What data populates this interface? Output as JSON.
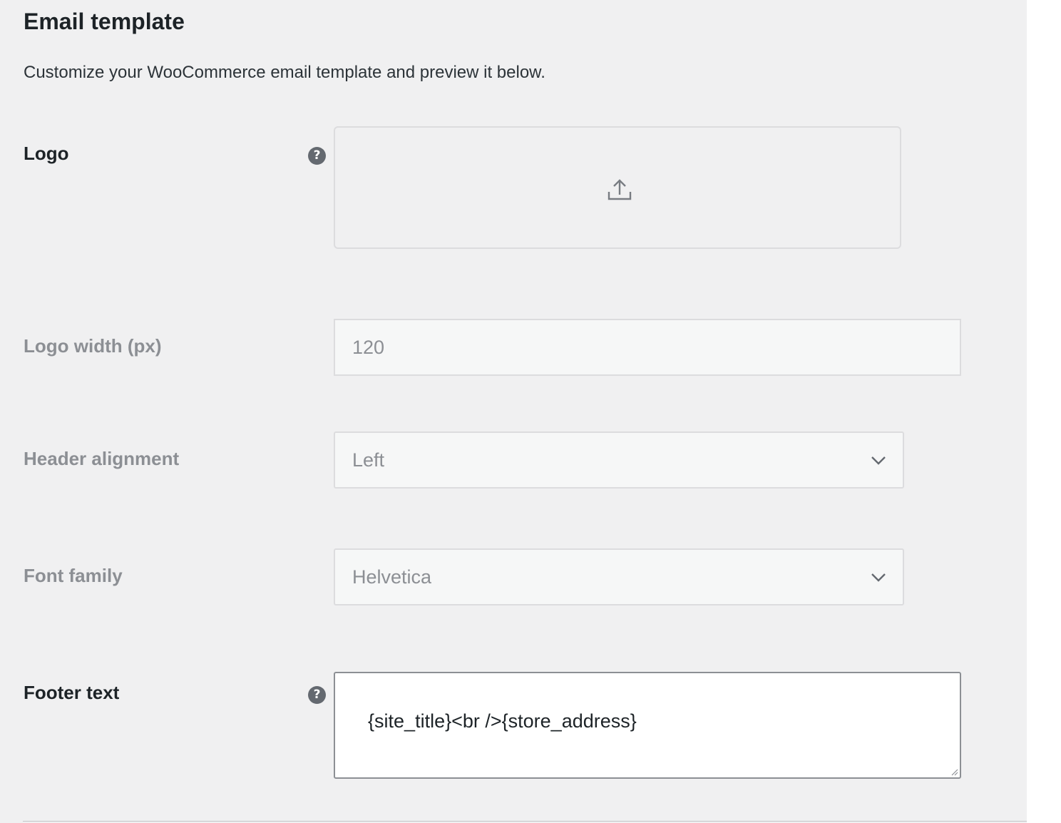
{
  "section": {
    "title": "Email template",
    "description": "Customize your WooCommerce email template and preview it below."
  },
  "fields": {
    "logo": {
      "label": "Logo",
      "help_icon": "?",
      "upload_icon": "upload-icon"
    },
    "logo_width": {
      "label": "Logo width (px)",
      "value": "120"
    },
    "header_alignment": {
      "label": "Header alignment",
      "value": "Left",
      "icon": "chevron-down-icon"
    },
    "font_family": {
      "label": "Font family",
      "value": "Helvetica",
      "icon": "chevron-down-icon"
    },
    "footer_text": {
      "label": "Footer text",
      "help_icon": "?",
      "value": "{site_title}<br />{store_address}"
    }
  },
  "colors": {
    "panel_background": "#f0f0f1",
    "label_active": "#1d2327",
    "label_muted": "#8c8f94",
    "input_border": "#dcdcde",
    "help_icon_bg": "#646970"
  }
}
